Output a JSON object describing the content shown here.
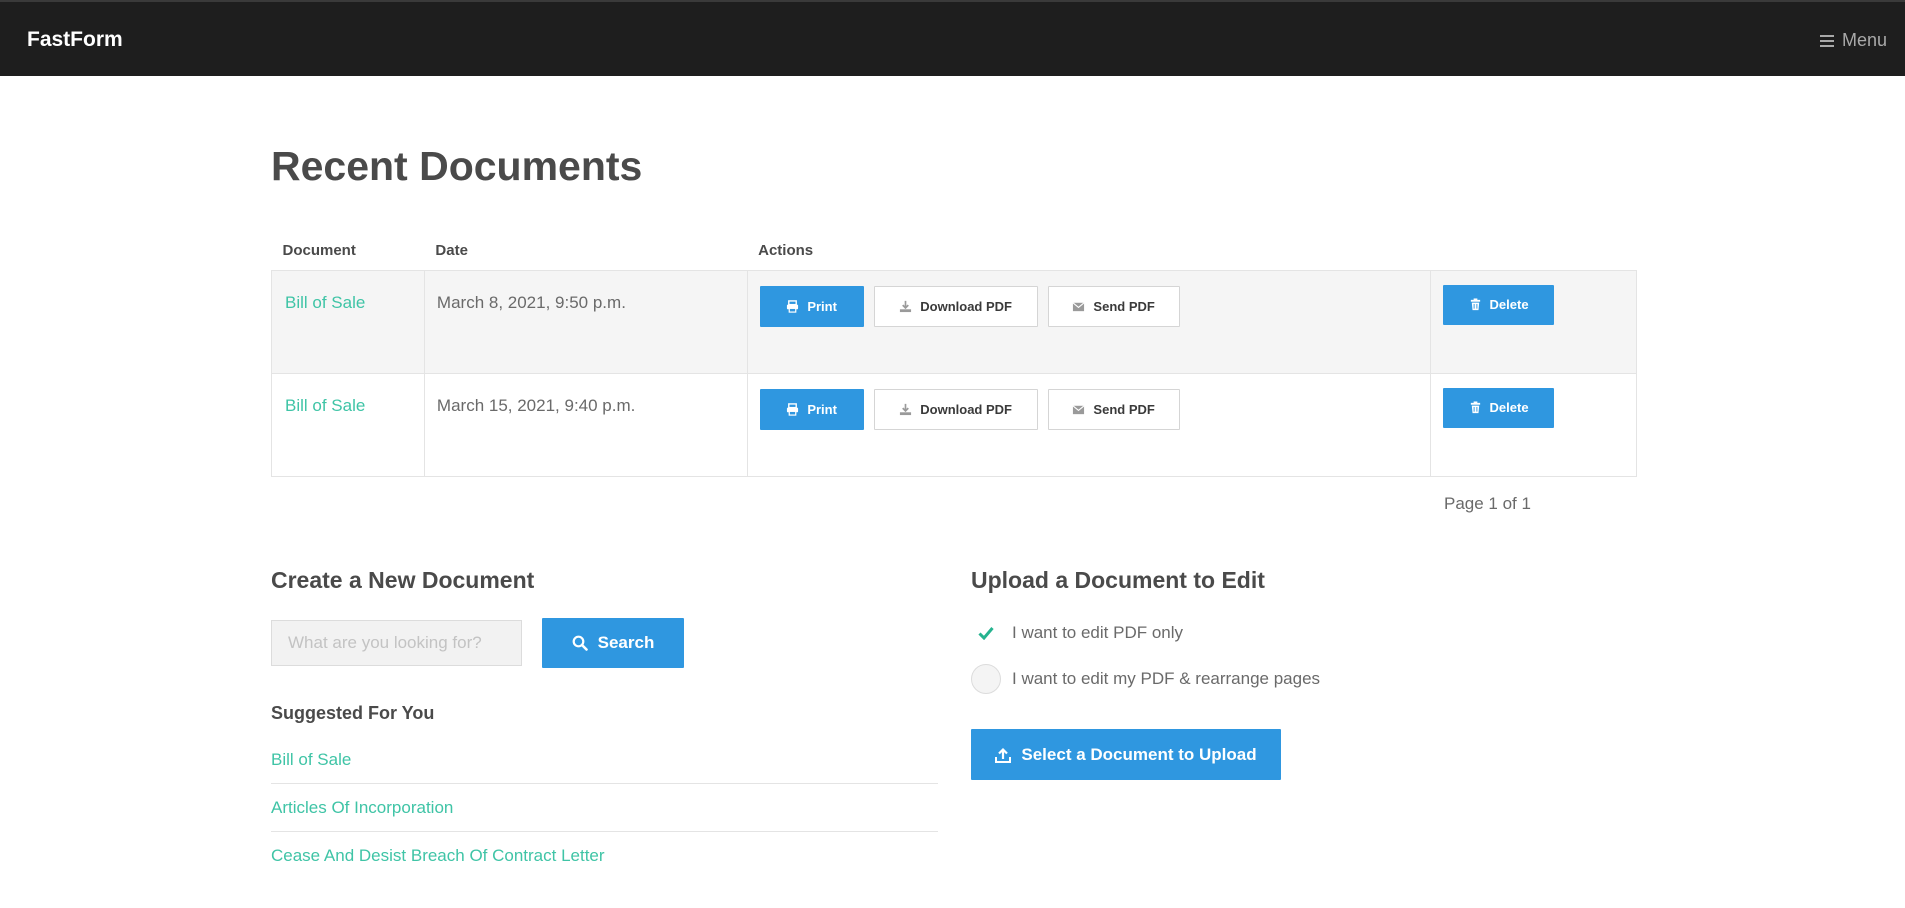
{
  "navbar": {
    "brand": "FastForm",
    "menu_label": "Menu"
  },
  "recent": {
    "title": "Recent Documents",
    "columns": [
      "Document",
      "Date",
      "Actions"
    ],
    "rows": [
      {
        "name": "Bill of Sale",
        "date": "March 8, 2021, 9:50 p.m."
      },
      {
        "name": "Bill of Sale",
        "date": "March 15, 2021, 9:40 p.m."
      }
    ],
    "buttons": {
      "print": "Print",
      "download": "Download PDF",
      "send": "Send PDF",
      "delete": "Delete"
    },
    "pager": "Page 1 of 1"
  },
  "create": {
    "title": "Create a New Document",
    "search_placeholder": "What are you looking for?",
    "search_value": "",
    "search_button": "Search",
    "suggested_title": "Suggested For You",
    "suggestions": [
      "Bill of Sale",
      "Articles Of Incorporation",
      "Cease And Desist Breach Of Contract Letter"
    ]
  },
  "upload": {
    "title": "Upload a Document to Edit",
    "options": [
      {
        "label": "I want to edit PDF only",
        "selected": true
      },
      {
        "label": "I want to edit my PDF & rearrange pages",
        "selected": false
      }
    ],
    "button": "Select a Document to Upload"
  },
  "colors": {
    "navbar": "#1e1e1e",
    "accent": "#2f97e0",
    "link": "#3fc4a6",
    "check": "#25b38f"
  },
  "icons": {
    "menu": "hamburger-icon",
    "print": "printer-icon",
    "download": "download-icon",
    "send": "envelope-icon",
    "delete": "trash-icon",
    "search": "search-icon",
    "upload": "upload-icon",
    "selected": "check-icon"
  }
}
